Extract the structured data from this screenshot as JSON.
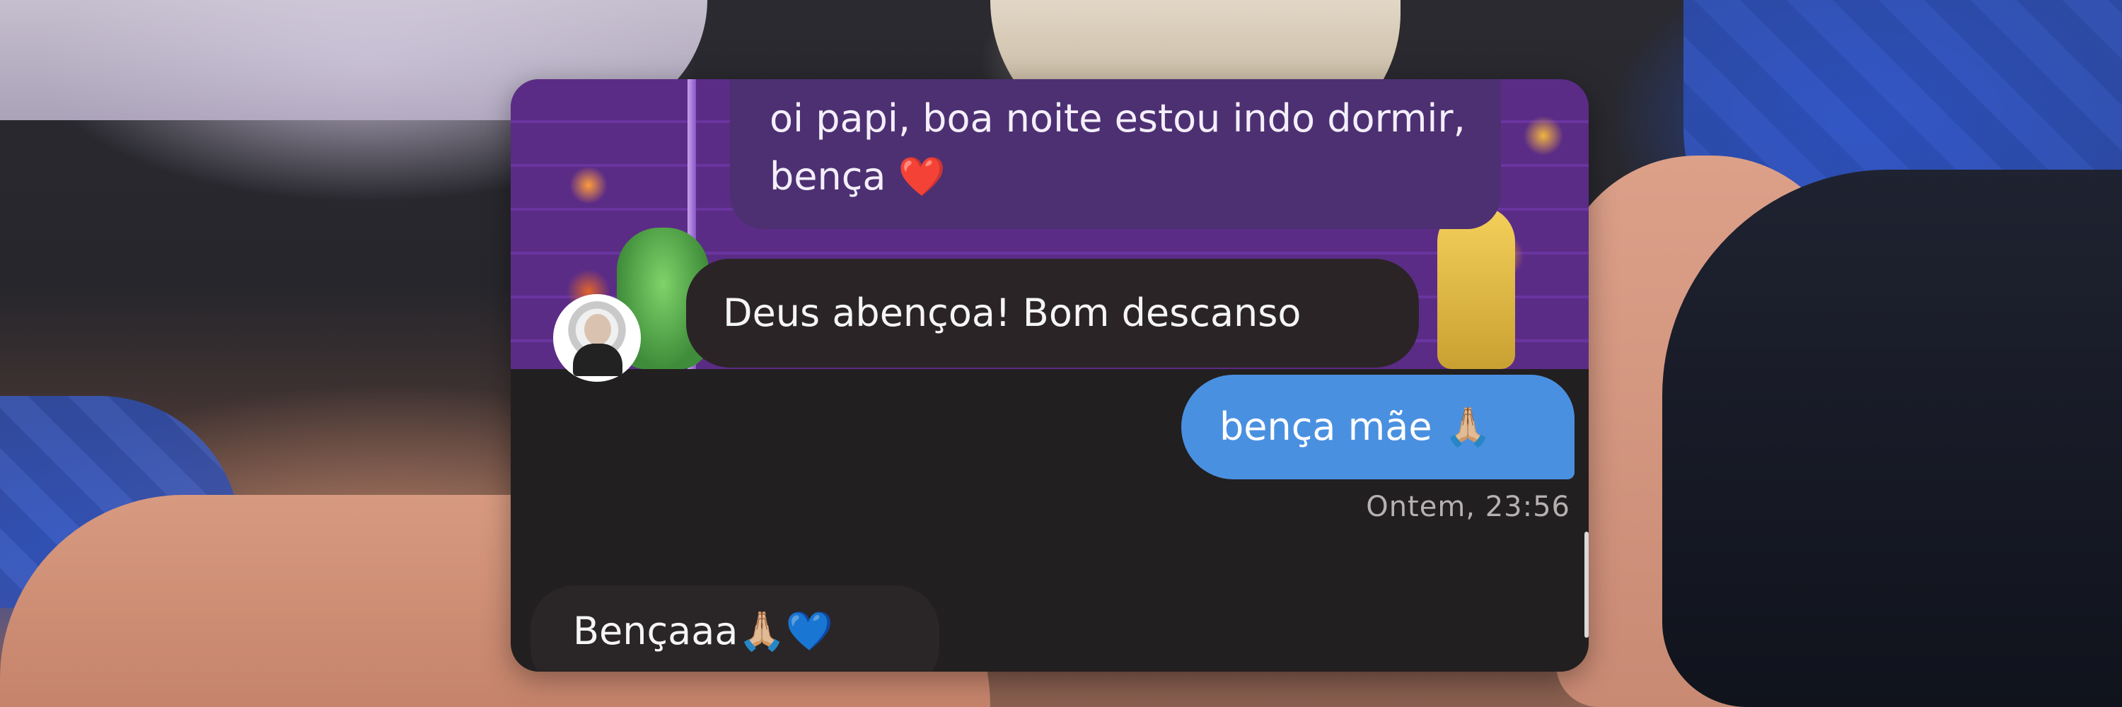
{
  "messages": {
    "sent_top": {
      "line1": "oi papi, boa noite estou indo dormir,",
      "line2": "bença ❤️"
    },
    "received_1": "Deus abençoa! Bom descanso",
    "sent_2": "bença mãe 🙏🏼",
    "timestamp": "Ontem, 23:56",
    "received_2": "Bençaaa🙏🏼💙"
  },
  "colors": {
    "sent_bubble_blue": "#4a90e0",
    "sent_bubble_purple": "#4d3072",
    "received_bubble": "#2b2426",
    "chat_background": "#221f20"
  },
  "icons": {
    "avatar": "contact-avatar"
  }
}
